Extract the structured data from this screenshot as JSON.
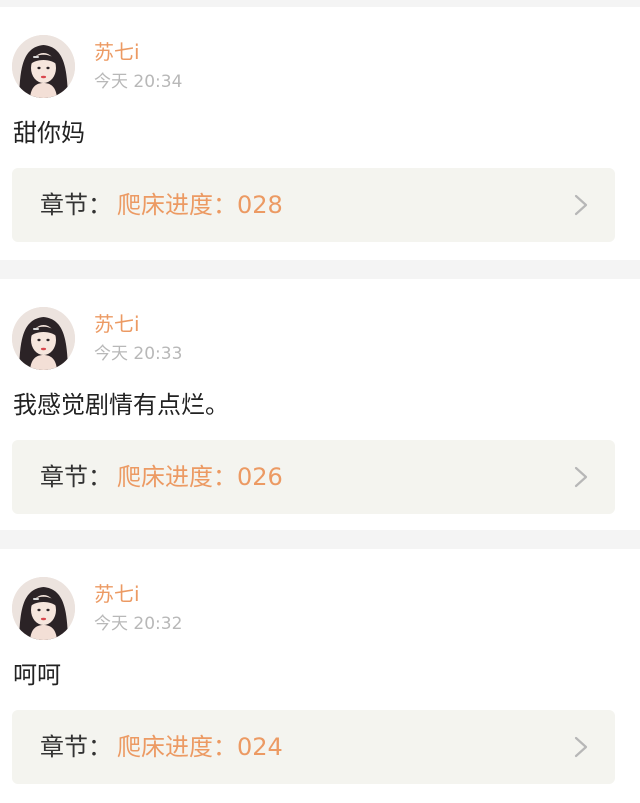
{
  "colors": {
    "accent": "#ec9a63",
    "time": "#b8b8b8",
    "text": "#222222",
    "chapter_bg": "#f4f4ef",
    "page_bg": "#f4f4f4"
  },
  "comments": [
    {
      "user": "苏七i",
      "time": "今天 20:34",
      "text": "甜你妈",
      "chapter_label": "章节：",
      "chapter_title": "爬床进度：028",
      "avatar_icon": "user-avatar-icon",
      "chevron_icon": "chevron-right-icon"
    },
    {
      "user": "苏七i",
      "time": "今天 20:33",
      "text": "我感觉剧情有点烂。",
      "chapter_label": "章节：",
      "chapter_title": "爬床进度：026",
      "avatar_icon": "user-avatar-icon",
      "chevron_icon": "chevron-right-icon"
    },
    {
      "user": "苏七i",
      "time": "今天 20:32",
      "text": "呵呵",
      "chapter_label": "章节：",
      "chapter_title": "爬床进度：024",
      "avatar_icon": "user-avatar-icon",
      "chevron_icon": "chevron-right-icon"
    }
  ]
}
